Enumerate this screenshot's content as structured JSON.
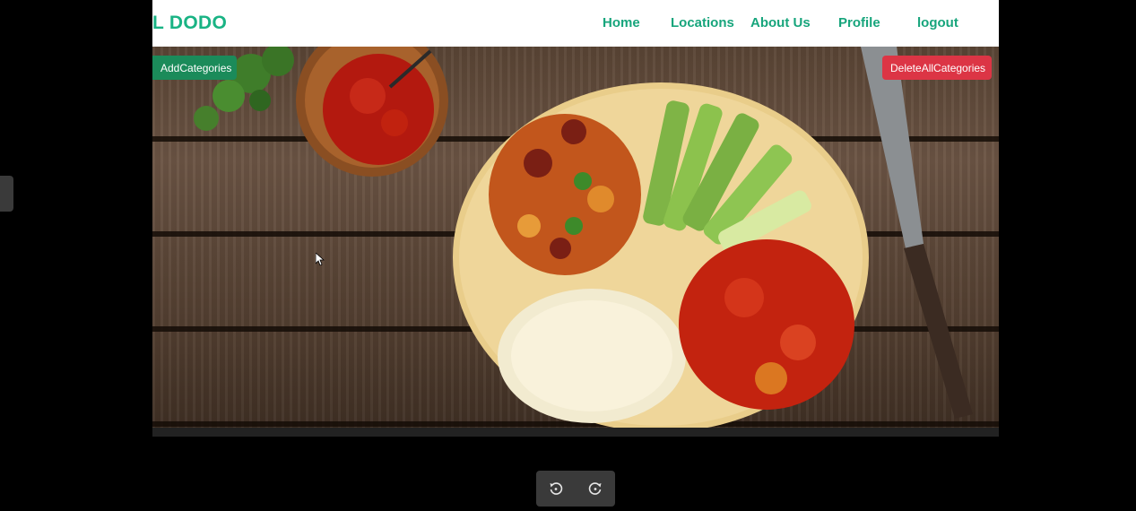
{
  "navbar": {
    "brand": "L DODO",
    "links": [
      "Home",
      "Locations",
      "About Us",
      "Profile",
      "logout"
    ]
  },
  "actions": {
    "add_label": "AddCategories",
    "delete_label": "DeleteAllCategories"
  },
  "hero": {
    "description": "food photo"
  },
  "viewer_controls": {
    "icons": [
      "rotate-left-icon",
      "rotate-right-icon"
    ]
  },
  "colors": {
    "brand": "#19b384",
    "nav_link": "#17a57c",
    "add_button": "#1b8b5a",
    "delete_button": "#dc3545"
  }
}
